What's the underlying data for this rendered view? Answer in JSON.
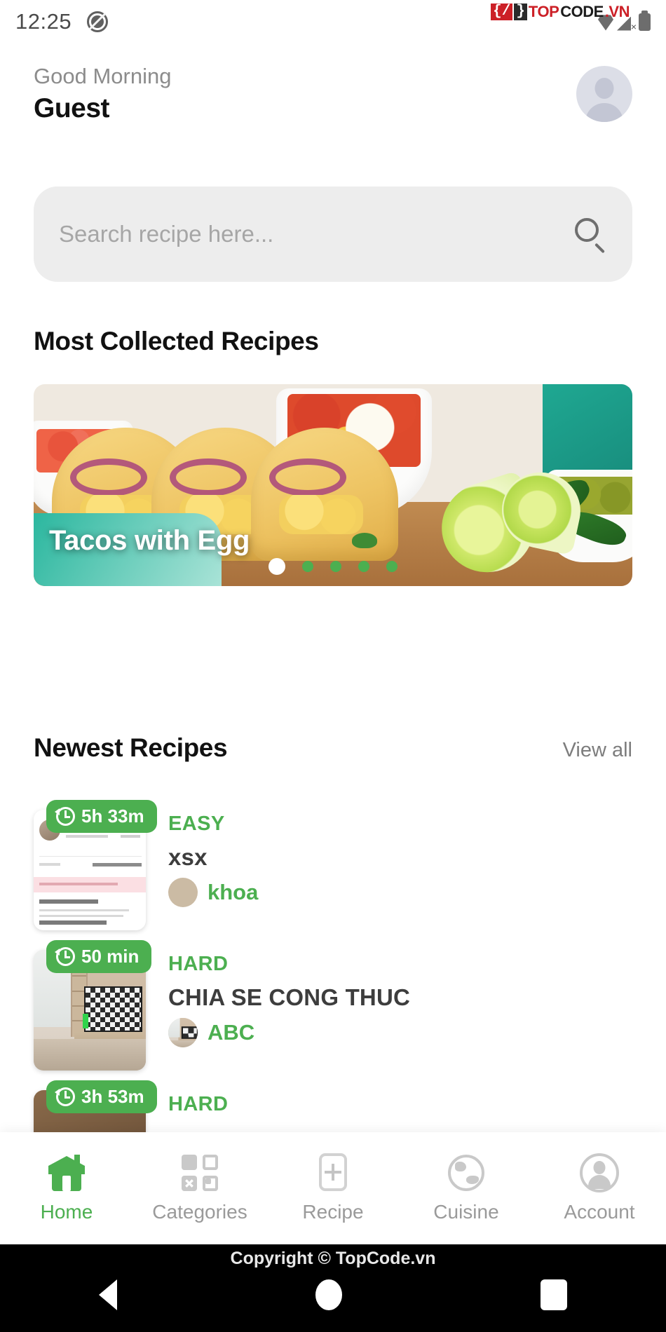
{
  "status_bar": {
    "time": "12:25",
    "silent_icon": "silent-mode-icon",
    "watermark": {
      "brace": "{/",
      "brace2": "}",
      "top": "TOP",
      "code": "CODE",
      "vn": ".VN"
    }
  },
  "header": {
    "greeting": "Good Morning",
    "username": "Guest",
    "avatar_icon": "user-avatar-icon"
  },
  "search": {
    "placeholder": "Search recipe here...",
    "icon": "search-icon"
  },
  "sections": {
    "most_collected_title": "Most Collected Recipes",
    "newest_title": "Newest Recipes",
    "view_all": "View all"
  },
  "hero": {
    "title": "Tacos with Egg",
    "dots_total": 5,
    "active_dot": 1,
    "active_color": "#ffffff",
    "idle_color": "#4caf50"
  },
  "recipes": [
    {
      "time": "5h 33m",
      "difficulty": "EASY",
      "name": "xsx",
      "author": "khoa",
      "thumb": "invoice-screenshot"
    },
    {
      "time": "50 min",
      "difficulty": "HARD",
      "name": "CHIA SE CONG THUC",
      "author": "ABC",
      "thumb": "room-with-tv"
    },
    {
      "time": "3h 53m",
      "difficulty": "HARD",
      "name": "",
      "author": "",
      "thumb": "partial"
    }
  ],
  "bottom_nav": {
    "watermark": "TopCode.vn",
    "items": [
      {
        "label": "Home",
        "icon": "home-icon",
        "active": true
      },
      {
        "label": "Categories",
        "icon": "grid-icon",
        "active": false
      },
      {
        "label": "Recipe",
        "icon": "plus-square-icon",
        "active": false
      },
      {
        "label": "Cuisine",
        "icon": "globe-icon",
        "active": false
      },
      {
        "label": "Account",
        "icon": "account-icon",
        "active": false
      }
    ]
  },
  "android_bar": {
    "copyright": "Copyright © TopCode.vn",
    "back_icon": "back-triangle-icon",
    "home_icon": "home-circle-icon",
    "recents_icon": "recents-square-icon"
  },
  "theme": {
    "accent": "#4caf50",
    "search_bg": "#ededed",
    "text_dark": "#111111"
  }
}
